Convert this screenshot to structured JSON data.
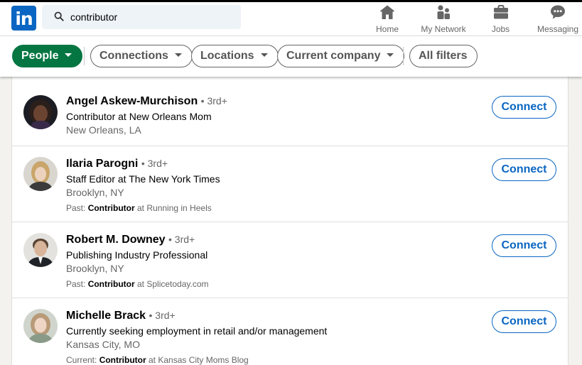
{
  "header": {
    "logo_text": "in",
    "search": {
      "value": "contributor",
      "placeholder": "Search"
    },
    "nav": [
      {
        "label": "Home",
        "icon": "home-icon"
      },
      {
        "label": "My Network",
        "icon": "network-icon"
      },
      {
        "label": "Jobs",
        "icon": "briefcase-icon"
      },
      {
        "label": "Messaging",
        "icon": "messaging-icon"
      }
    ]
  },
  "filters": [
    {
      "label": "People",
      "active": true
    },
    {
      "label": "Connections",
      "active": false
    },
    {
      "label": "Locations",
      "active": false
    },
    {
      "label": "Current company",
      "active": false
    },
    {
      "label": "All filters",
      "active": false
    }
  ],
  "results": [
    {
      "name": "Angel Askew-Murchison",
      "degree": "• 3rd+",
      "headline": "Contributor at New Orleans Mom",
      "location": "New Orleans, LA",
      "snippet": null,
      "action": "Connect"
    },
    {
      "name": "Ilaria Parogni",
      "degree": "• 3rd+",
      "headline": "Staff Editor at The New York Times",
      "location": "Brooklyn, NY",
      "snippet": {
        "prefix": "Past: ",
        "keyword": "Contributor",
        "suffix": " at Running in Heels"
      },
      "action": "Connect"
    },
    {
      "name": "Robert M. Downey",
      "degree": "• 3rd+",
      "headline": "Publishing Industry Professional",
      "location": "Brooklyn, NY",
      "snippet": {
        "prefix": "Past: ",
        "keyword": "Contributor",
        "suffix": " at Splicetoday.com"
      },
      "action": "Connect"
    },
    {
      "name": "Michelle Brack",
      "degree": "• 3rd+",
      "headline": "Currently seeking employment in retail and/or management",
      "location": "Kansas City, MO",
      "snippet": {
        "prefix": "Current: ",
        "keyword": "Contributor",
        "suffix": " at Kansas City Moms Blog"
      },
      "action": "Connect"
    }
  ],
  "colors": {
    "brand": "#0a66c2",
    "active_filter": "#057642",
    "page_bg": "#f3f2ef"
  }
}
